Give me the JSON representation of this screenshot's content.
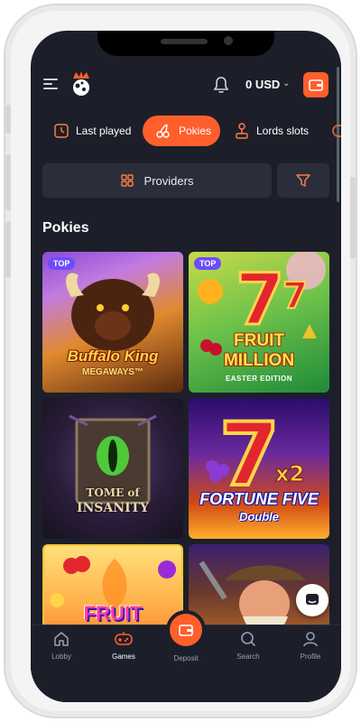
{
  "header": {
    "balance": "0 USD",
    "balance_chevron": "⌄"
  },
  "tabs": [
    {
      "label": "Last played",
      "icon": "clock-icon"
    },
    {
      "label": "Pokies",
      "icon": "cherry-icon",
      "active": true
    },
    {
      "label": "Lords slots",
      "icon": "joystick-icon"
    }
  ],
  "filters": {
    "providers_label": "Providers"
  },
  "section": {
    "title": "Pokies"
  },
  "games": [
    {
      "title_line1": "Buffalo King",
      "title_line2": "MEGAWAYS™",
      "badge": "TOP"
    },
    {
      "title_line1": "FRUIT",
      "title_line2": "MILLION",
      "title_line3": "EASTER EDITION",
      "badge": "TOP"
    },
    {
      "title_line1": "TOME of",
      "title_line2": "INSANITY"
    },
    {
      "title_line1": "FORTUNE FIVE",
      "title_line2": "Double"
    },
    {
      "title_line1": "FRUIT"
    },
    {}
  ],
  "bottom_nav": [
    {
      "label": "Lobby",
      "icon": "home-icon"
    },
    {
      "label": "Games",
      "icon": "gamepad-icon",
      "active": true
    },
    {
      "label": "Deposit",
      "icon": "wallet-icon"
    },
    {
      "label": "Search",
      "icon": "search-icon"
    },
    {
      "label": "Profile",
      "icon": "user-icon"
    }
  ],
  "colors": {
    "accent": "#ff5f2b",
    "background": "#1c1f2a",
    "surface": "#2a2e3b",
    "badge": "#6d4bff"
  }
}
